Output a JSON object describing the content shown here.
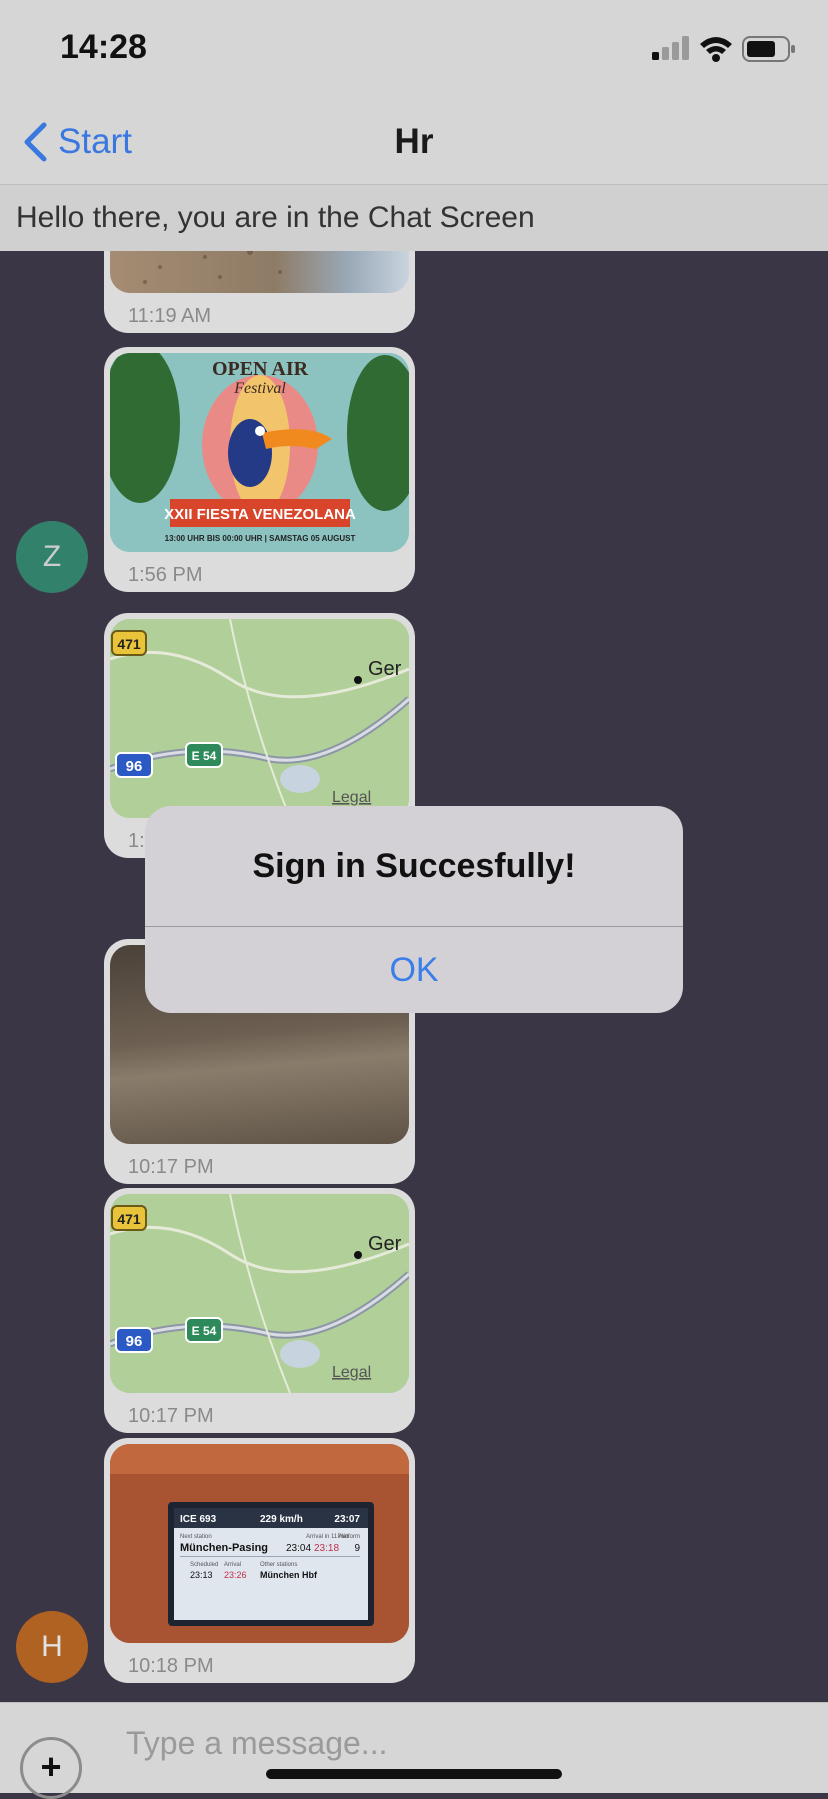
{
  "status_bar": {
    "time": "14:28"
  },
  "nav": {
    "back_label": "Start",
    "title": "Hr"
  },
  "banner": {
    "text": "Hello there, you are in the Chat Screen"
  },
  "avatars": [
    {
      "initial": "Z",
      "color": "#2e9a78"
    },
    {
      "initial": "H",
      "color": "#c56a1c"
    }
  ],
  "messages": [
    {
      "kind": "photo-beach",
      "time": "11:19 AM"
    },
    {
      "kind": "festival-poster",
      "time": "1:56 PM"
    },
    {
      "kind": "map",
      "time": "1:5"
    },
    {
      "kind": "photo-dark",
      "time": "10:17 PM"
    },
    {
      "kind": "map",
      "time": "10:17 PM"
    },
    {
      "kind": "train-display",
      "time": "10:18 PM"
    }
  ],
  "poster": {
    "title": "OPEN AIR",
    "subtitle": "Festival",
    "banner": "XXII FIESTA VENEZOLANA",
    "details": "13:00 UHR BIS 00:00 UHR | SAMSTAG 05 AUGUST"
  },
  "map": {
    "road_a": "471",
    "road_b": "96",
    "road_c": "E 54",
    "place": "Ger",
    "legal": "Legal"
  },
  "train": {
    "train_no": "ICE 693",
    "speed": "229 km/h",
    "clock": "23:07",
    "next_label": "Next station",
    "arrival_label": "Arrival in 11 min",
    "platform_label": "Platform",
    "next_station": "München-Pasing",
    "sched": "23:04",
    "actual": "23:18",
    "platform": "9",
    "sched_label": "Scheduled",
    "arr_label": "Arrival",
    "other_label": "Other stations",
    "t1": "23:13",
    "t2": "23:26",
    "dest": "München Hbf"
  },
  "alert": {
    "title": "Sign in Succesfully!",
    "ok_label": "OK"
  },
  "composer": {
    "placeholder": "Type a message...",
    "plus": "+"
  },
  "colors": {
    "accent": "#3a78e0",
    "chat_bg": "#3a3646"
  }
}
